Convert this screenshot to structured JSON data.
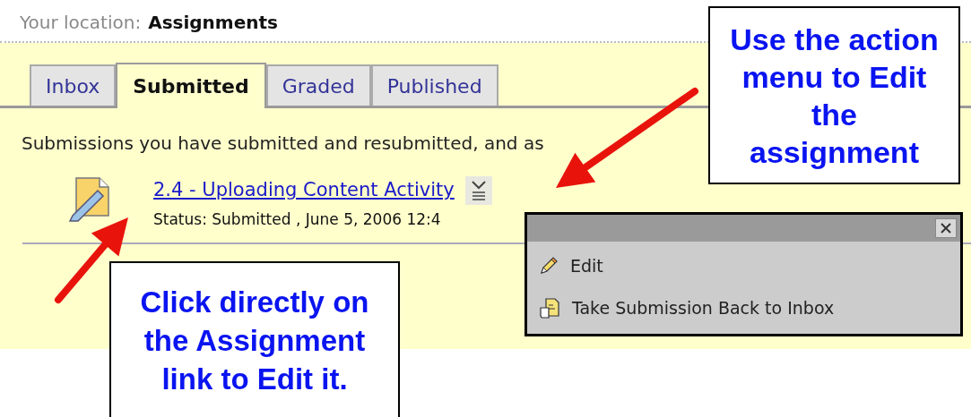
{
  "location": {
    "label": "Your location:",
    "value": "Assignments"
  },
  "tabs": [
    {
      "label": "Inbox",
      "selected": false
    },
    {
      "label": "Submitted",
      "selected": true
    },
    {
      "label": "Graded",
      "selected": false
    },
    {
      "label": "Published",
      "selected": false
    }
  ],
  "description": "Submissions you have submitted and resubmitted, and as",
  "submissions": [
    {
      "title": "2.4 - Uploading Content Activity",
      "status": "Status: Submitted , June 5, 2006 12:4"
    }
  ],
  "action_menu": {
    "items": [
      {
        "label": "Edit",
        "kind": "edit"
      },
      {
        "label": "Take Submission Back to Inbox",
        "kind": "retract"
      }
    ]
  },
  "callouts": [
    {
      "text": "Use the action menu to Edit the assignment"
    },
    {
      "text": "Click directly on the Assignment link to Edit it."
    }
  ]
}
